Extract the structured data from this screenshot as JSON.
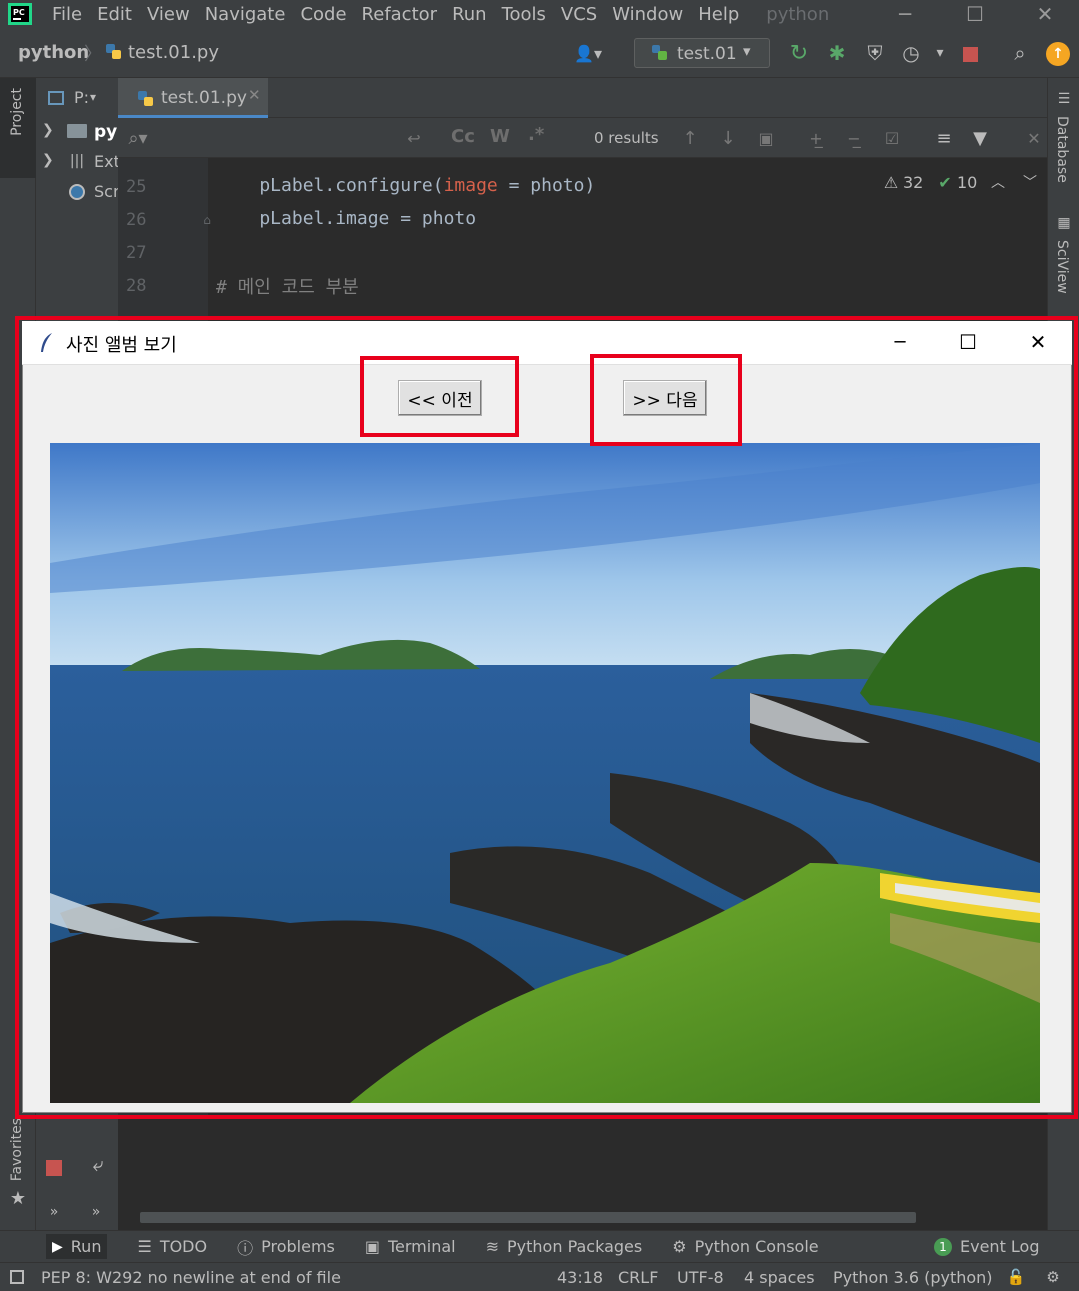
{
  "menu": {
    "items": [
      "File",
      "Edit",
      "View",
      "Navigate",
      "Code",
      "Refactor",
      "Run",
      "Tools",
      "VCS",
      "Window",
      "Help"
    ],
    "project_name": "python"
  },
  "nav": {
    "breadcrumb_project": "python",
    "breadcrumb_file": "test.01.py",
    "run_config": "test.01"
  },
  "project_panel": {
    "header": "P:",
    "items": [
      "py",
      "Ext",
      "Scr"
    ]
  },
  "editor": {
    "tab_label": "test.01.py",
    "find": {
      "case_label": "Cc",
      "word_label": "W",
      "regex_label": ".*",
      "results": "0 results"
    },
    "inspections": {
      "warnings": "32",
      "weak_warnings": "10"
    },
    "line_numbers": [
      "25",
      "26",
      "27",
      "28"
    ],
    "lines": [
      {
        "pre": "    pLabel.configure(",
        "kw": "image",
        "mid": " = ",
        "post": "photo)"
      },
      {
        "text": "    pLabel.image = photo"
      },
      {
        "text": ""
      },
      {
        "comment": "# 메인 코드 부분"
      }
    ]
  },
  "tk_window": {
    "title": "사진 앨범 보기",
    "prev_button": "<< 이전",
    "next_button": ">> 다음",
    "photo_desc": "coastal landscape"
  },
  "left_strip": {
    "project": "Project",
    "favorites": "Favorites"
  },
  "right_strip": {
    "database": "Database",
    "sciview": "SciView"
  },
  "tool_windows": {
    "run": "Run",
    "todo": "TODO",
    "problems": "Problems",
    "terminal": "Terminal",
    "packages": "Python Packages",
    "console": "Python Console",
    "event_log_count": "1",
    "event_log": "Event Log"
  },
  "status": {
    "message": "PEP 8: W292 no newline at end of file",
    "position": "43:18",
    "line_sep": "CRLF",
    "encoding": "UTF-8",
    "indent": "4 spaces",
    "interpreter": "Python 3.6 (python)"
  },
  "colors": {
    "accent_red": "#e8001c",
    "keyword_orange": "#cc7832",
    "param_red": "#d5614b",
    "comment": "#808080"
  }
}
